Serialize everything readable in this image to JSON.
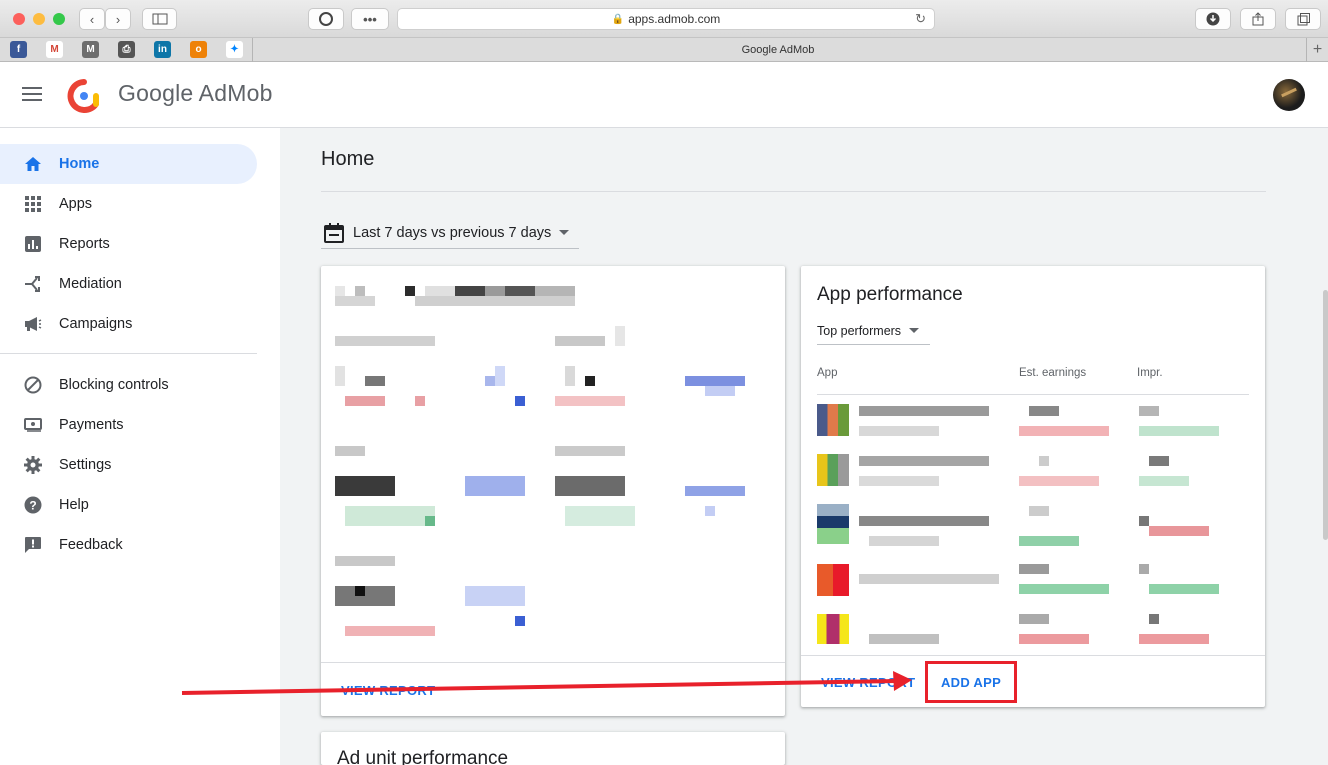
{
  "browser": {
    "url": "apps.admob.com",
    "tab_title": "Google AdMob",
    "bookmarks": [
      "facebook-icon",
      "gmail-icon",
      "m-icon",
      "printer-icon",
      "linkedin-icon",
      "ok-icon",
      "messenger-icon"
    ]
  },
  "app": {
    "brand": "Google AdMob"
  },
  "sidebar": {
    "items": [
      {
        "label": "Home",
        "icon": "home-icon"
      },
      {
        "label": "Apps",
        "icon": "apps-grid-icon"
      },
      {
        "label": "Reports",
        "icon": "reports-icon"
      },
      {
        "label": "Mediation",
        "icon": "mediation-icon"
      },
      {
        "label": "Campaigns",
        "icon": "megaphone-icon"
      },
      {
        "label": "Blocking controls",
        "icon": "block-icon"
      },
      {
        "label": "Payments",
        "icon": "payments-icon"
      },
      {
        "label": "Settings",
        "icon": "gear-icon"
      },
      {
        "label": "Help",
        "icon": "help-icon"
      },
      {
        "label": "Feedback",
        "icon": "feedback-icon"
      }
    ]
  },
  "main": {
    "page_title": "Home",
    "date_range": "Last 7 days vs previous 7 days",
    "summary_card": {
      "view_report": "VIEW REPORT"
    },
    "app_performance": {
      "title": "App performance",
      "filter": "Top performers",
      "columns": [
        "App",
        "Est. earnings",
        "Impr."
      ],
      "view_report": "VIEW REPORT",
      "add_app": "ADD APP"
    },
    "ad_unit_performance": {
      "title": "Ad unit performance"
    }
  },
  "colors": {
    "accent": "#1a73e8",
    "annotation": "#e8212b"
  }
}
